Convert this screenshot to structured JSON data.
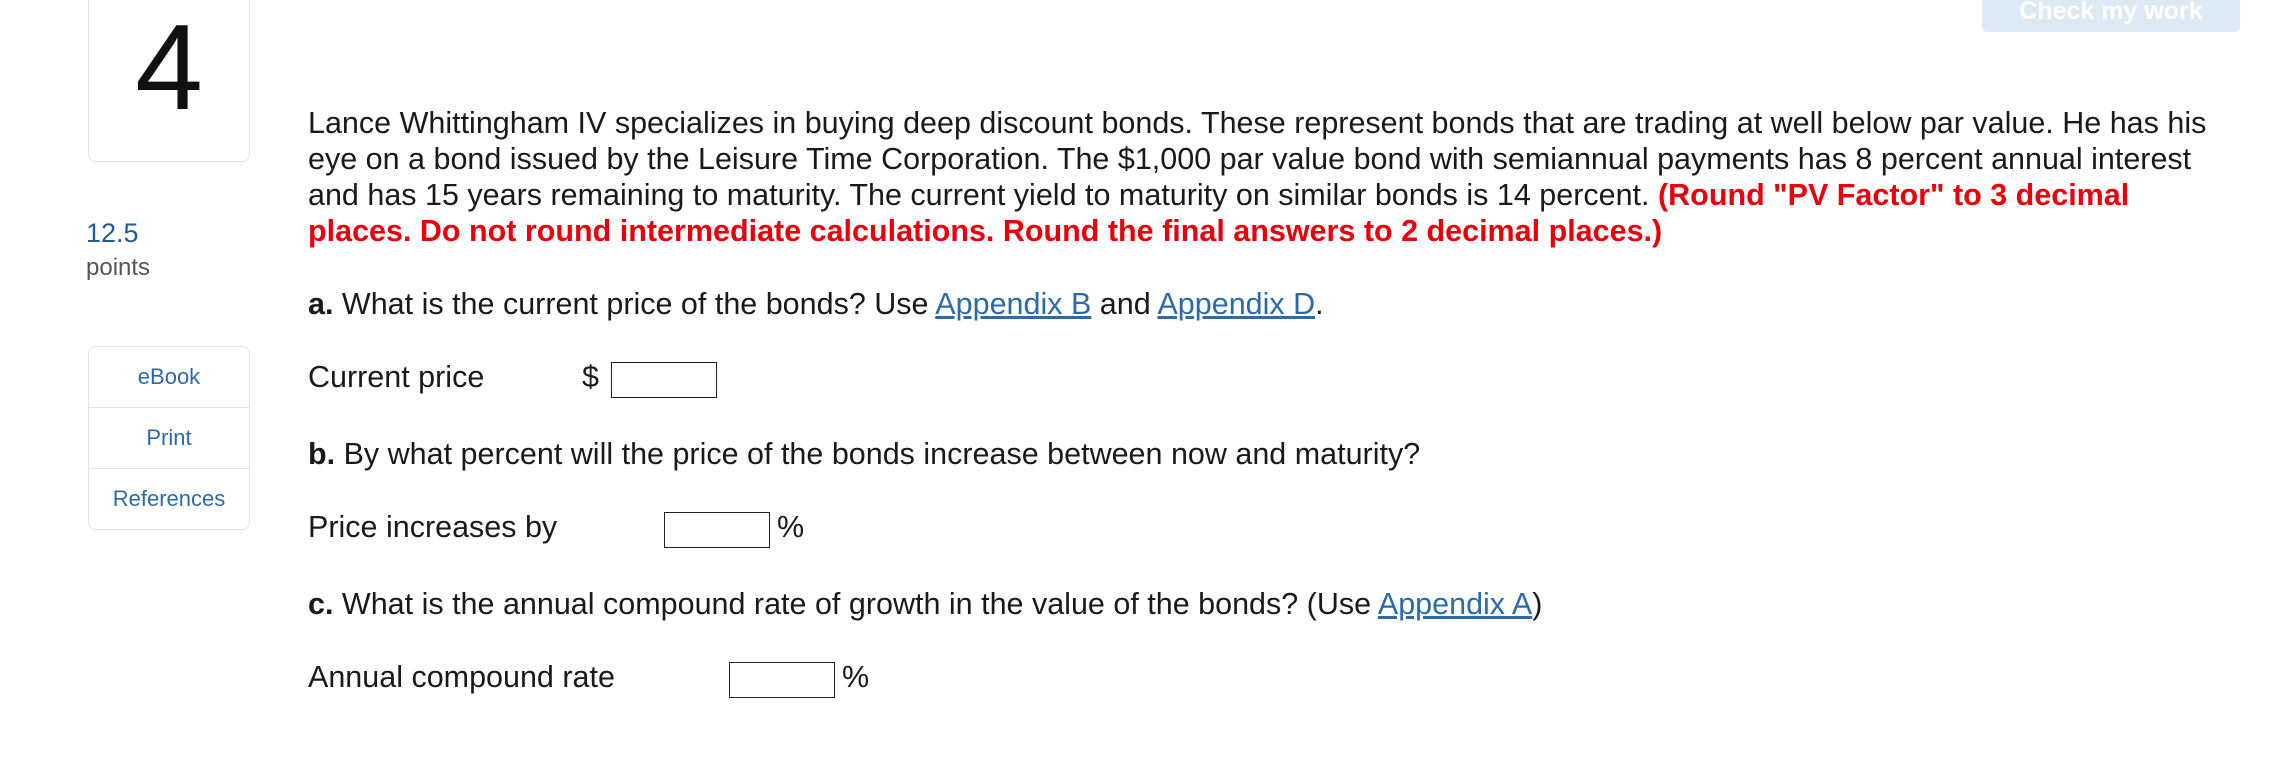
{
  "question": {
    "number": "4",
    "points_value": "12.5",
    "points_label": "points"
  },
  "resources": {
    "ebook": "eBook",
    "print": "Print",
    "references": "References"
  },
  "header": {
    "check_button": "Check my work"
  },
  "problem": {
    "text": "Lance Whittingham IV specializes in buying deep discount bonds. These represent bonds that are trading at well below par value. He has his eye on a bond issued by the Leisure Time Corporation. The $1,000 par value bond with semiannual payments has 8 percent annual interest and has 15 years remaining to maturity. The current yield to maturity on similar bonds is 14 percent.",
    "instructions": "(Round \"PV Factor\" to 3 decimal places. Do not round intermediate calculations. Round the final answers to 2 decimal places.)"
  },
  "part_a": {
    "letter": "a.",
    "question": "What is the current price of the bonds? Use",
    "link1": "Appendix B",
    "and": "and",
    "link2": "Appendix D",
    "end": ".",
    "label": "Current price",
    "prefix": "$",
    "value": ""
  },
  "part_b": {
    "letter": "b.",
    "question": "By what percent will the price of the bonds increase between now and maturity?",
    "label": "Price increases by",
    "suffix": "%",
    "value": ""
  },
  "part_c": {
    "letter": "c.",
    "question": "What is the annual compound rate of growth in the value of the bonds? (Use",
    "link": "Appendix A",
    "end": ")",
    "label": "Annual compound rate",
    "suffix": "%",
    "value": ""
  },
  "colors": {
    "link": "#2c6aa8",
    "instruction_red": "#e8000b",
    "points_blue": "#1f5c99",
    "button_bg": "#dde9f5"
  }
}
